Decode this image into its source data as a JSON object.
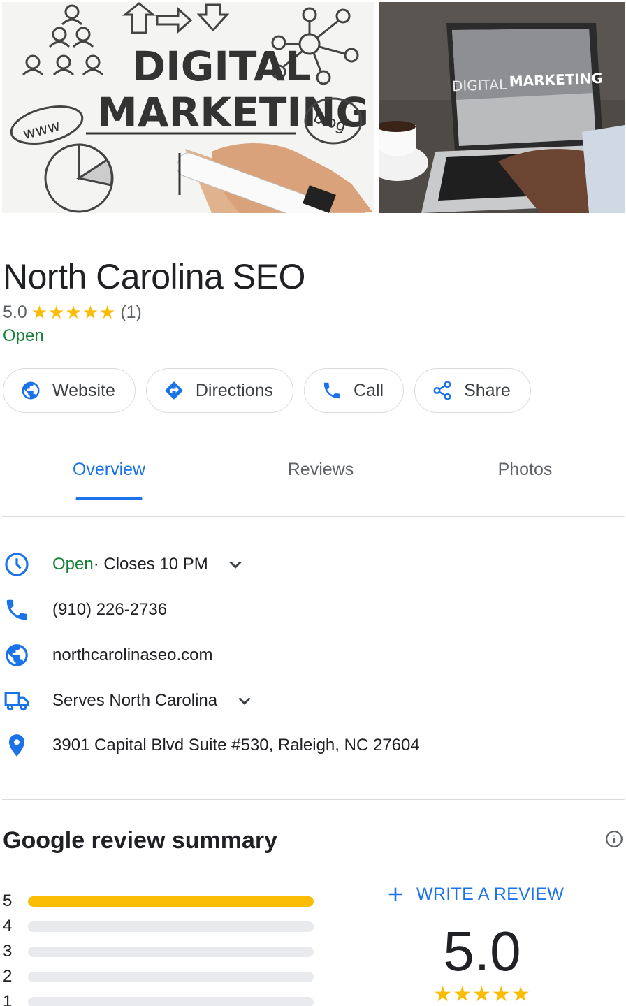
{
  "header_photos": {
    "left": {
      "text_line1": "DIGITAL",
      "text_line2": "MARKETING",
      "www": "www",
      "blog": "blog"
    },
    "right": {
      "screen_text_part1": "DIGITAL",
      "screen_text_part2": "MARKETING"
    }
  },
  "business": {
    "name": "North Carolina SEO",
    "rating": "5.0",
    "stars": "★★★★★",
    "review_count": "(1)",
    "status": "Open"
  },
  "actions": [
    {
      "label": "Website",
      "icon": "globe-icon"
    },
    {
      "label": "Directions",
      "icon": "directions-icon"
    },
    {
      "label": "Call",
      "icon": "phone-icon"
    },
    {
      "label": "Share",
      "icon": "share-icon"
    }
  ],
  "tabs": [
    {
      "label": "Overview",
      "active": true
    },
    {
      "label": "Reviews",
      "active": false
    },
    {
      "label": "Photos",
      "active": false
    }
  ],
  "info": {
    "hours_status": "Open",
    "hours_detail": " · Closes 10 PM",
    "phone": "(910) 226-2736",
    "website": "northcarolinaseo.com",
    "service_area": "Serves North Carolina",
    "address": "3901 Capital Blvd Suite #530, Raleigh, NC 27604"
  },
  "review_summary": {
    "title": "Google review summary",
    "write_review_label": "WRITE A REVIEW",
    "average": "5.0",
    "stars": "★★★★★",
    "distribution": [
      {
        "stars": "5",
        "fraction": 1.0
      },
      {
        "stars": "4",
        "fraction": 0
      },
      {
        "stars": "3",
        "fraction": 0
      },
      {
        "stars": "2",
        "fraction": 0
      },
      {
        "stars": "1",
        "fraction": 0
      }
    ]
  },
  "colors": {
    "accent_blue": "#1a73e8",
    "open_green": "#188038",
    "star_yellow": "#fbbc04"
  }
}
